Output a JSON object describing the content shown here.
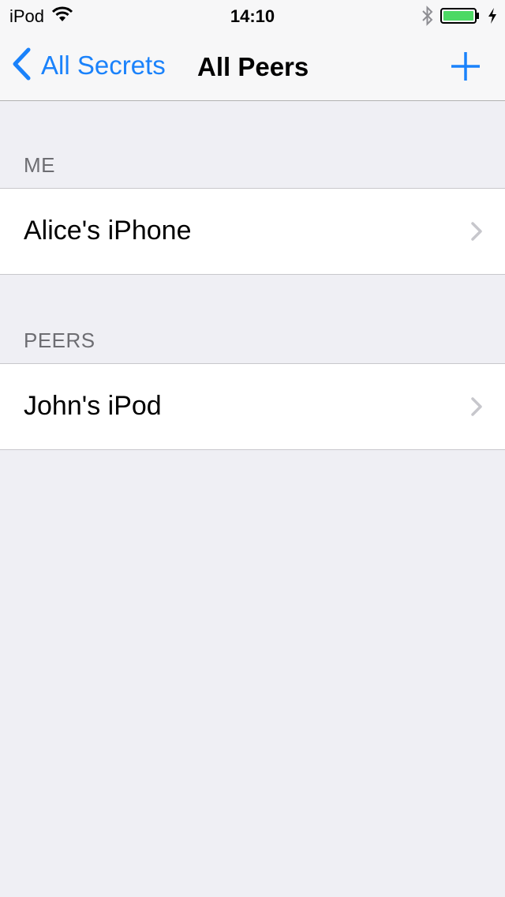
{
  "status_bar": {
    "carrier": "iPod",
    "time": "14:10",
    "icons": [
      "wifi-icon",
      "bluetooth-icon",
      "battery-icon",
      "charging-bolt-icon"
    ]
  },
  "nav": {
    "back_label": "All Secrets",
    "title": "All Peers",
    "back_icon": "chevron-left-icon",
    "add_icon": "plus-icon"
  },
  "sections": [
    {
      "header": "ME",
      "items": [
        {
          "label": "Alice's iPhone"
        }
      ]
    },
    {
      "header": "PEERS",
      "items": [
        {
          "label": "John's iPod"
        }
      ]
    }
  ],
  "colors": {
    "accent": "#1a82fb",
    "background": "#efeff4",
    "battery_fill": "#4cd964"
  }
}
